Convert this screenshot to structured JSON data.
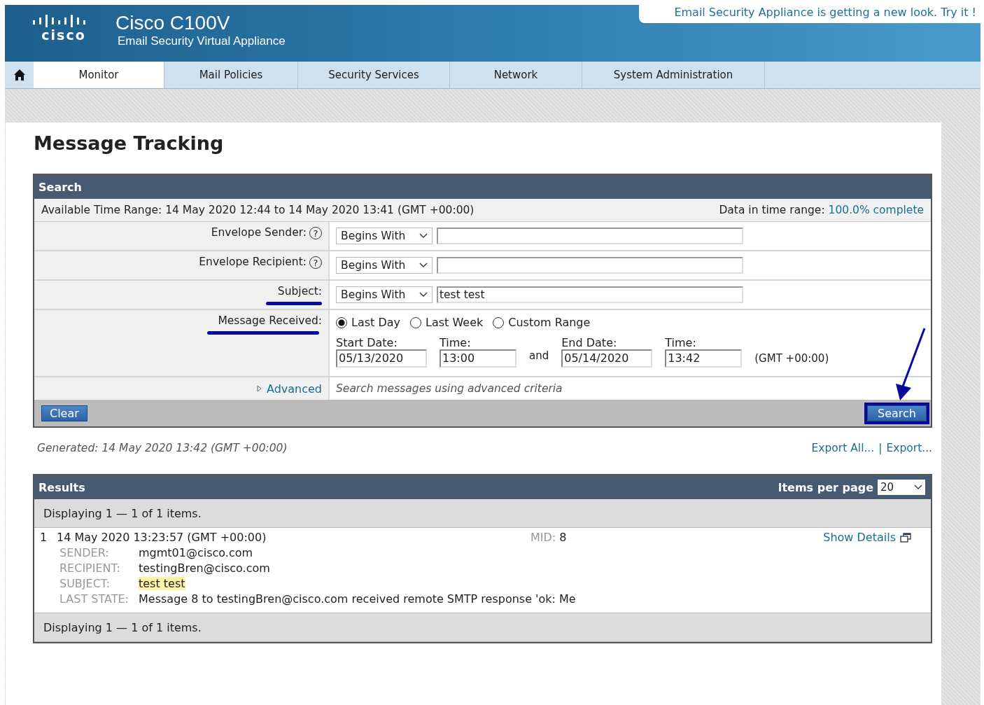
{
  "header": {
    "logo_text": "cisco",
    "product": "Cisco C100V",
    "subtitle": "Email Security Virtual Appliance",
    "banner": "Email Security Appliance is getting a new look. Try it !"
  },
  "nav": [
    {
      "label": "Monitor",
      "selected": true
    },
    {
      "label": "Mail Policies",
      "selected": false
    },
    {
      "label": "Security Services",
      "selected": false
    },
    {
      "label": "Network",
      "selected": false
    },
    {
      "label": "System Administration",
      "selected": false
    }
  ],
  "page_title": "Message Tracking",
  "search": {
    "title": "Search",
    "time_range": "Available Time Range: 14 May 2020 12:44 to 14 May 2020 13:41 (GMT +00:00)",
    "data_label": "Data in time range:",
    "data_value": "100.0% complete",
    "rows": [
      {
        "label": "Envelope Sender:",
        "help": "?",
        "operator": "Begins With",
        "underlined": false
      },
      {
        "label": "Envelope Recipient:",
        "help": "?",
        "operator": "Begins With",
        "underlined": false
      },
      {
        "label": "Subject:",
        "operator": "Begins With",
        "value": "test test",
        "underlined": true
      }
    ],
    "received": {
      "label": "Message Received:",
      "underlined": true,
      "options": [
        {
          "label": "Last Day",
          "selected": true
        },
        {
          "label": "Last Week",
          "selected": false
        },
        {
          "label": "Custom Range",
          "selected": false
        }
      ],
      "start_date_label": "Start Date:",
      "start_date": "05/13/2020",
      "start_time_label": "Time:",
      "start_time": "13:00",
      "and": "and",
      "end_date_label": "End Date:",
      "end_date": "05/14/2020",
      "end_time_label": "Time:",
      "end_time": "13:42",
      "timezone": "(GMT +00:00)"
    },
    "advanced": {
      "label": "Advanced",
      "description": "Search messages using advanced criteria"
    },
    "clear_button": "Clear",
    "search_button": "Search",
    "search_highlighted": true
  },
  "generated": "Generated: 14 May 2020 13:42 (GMT +00:00)",
  "export_links": [
    "Export All...",
    "Export..."
  ],
  "export_separator": "|",
  "results": {
    "title": "Results",
    "per_page_label": "Items per page",
    "per_page": "20",
    "displaying_top": "Displaying 1 — 1 of 1 items.",
    "items": [
      {
        "index": "1",
        "date": "14 May 2020 13:23:57 (GMT +00:00)",
        "mid_label": "MID:",
        "mid": "8",
        "details_link": "Show Details",
        "fields": [
          {
            "label": "SENDER:",
            "value": "mgmt01@cisco.com",
            "highlighted": false
          },
          {
            "label": "RECIPIENT:",
            "value": "testingBren@cisco.com",
            "highlighted": false
          },
          {
            "label": "SUBJECT:",
            "value": "test test",
            "highlighted": true
          },
          {
            "label": "LAST STATE:",
            "value": "Message 8 to testingBren@cisco.com received remote SMTP response 'ok: Me",
            "highlighted": false
          }
        ]
      }
    ],
    "displaying_bottom": "Displaying 1 — 1 of 1 items."
  }
}
